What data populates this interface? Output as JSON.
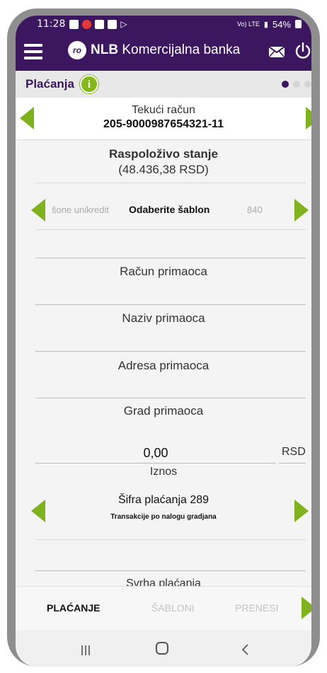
{
  "status_bar": {
    "time": "11:28",
    "network": "Vo) LTE",
    "battery": "54%"
  },
  "app_header": {
    "brand_bold": "NLB",
    "brand_rest": " Komercijalna banka",
    "logo_text": "ro"
  },
  "section": {
    "title": "Plaćanja",
    "info_symbol": "i"
  },
  "account": {
    "type": "Tekući račun",
    "number": "205-9000987654321-11"
  },
  "balance": {
    "label": "Raspoloživo stanje",
    "value": "(48.436,38 RSD)"
  },
  "template": {
    "prev": "šone unikredit",
    "label": "Odaberite šablon",
    "next": "840"
  },
  "form": {
    "account_label": "Račun primaoca",
    "name_label": "Naziv primaoca",
    "address_label": "Adresa primaoca",
    "city_label": "Grad primaoca",
    "amount_value": "0,00",
    "currency": "RSD",
    "amount_label": "Iznos",
    "payment_code_label": "Šifra plaćanja 289",
    "payment_code_desc": "Transakcije po nalogu gradjana",
    "purpose_label": "Svrha plaćanja"
  },
  "tabs": [
    {
      "label": "PLAĆANJE"
    },
    {
      "label": "ŠABLONI"
    },
    {
      "label": "PRENESI"
    }
  ],
  "colors": {
    "brand": "#3c1760",
    "accent": "#7fb21d"
  }
}
